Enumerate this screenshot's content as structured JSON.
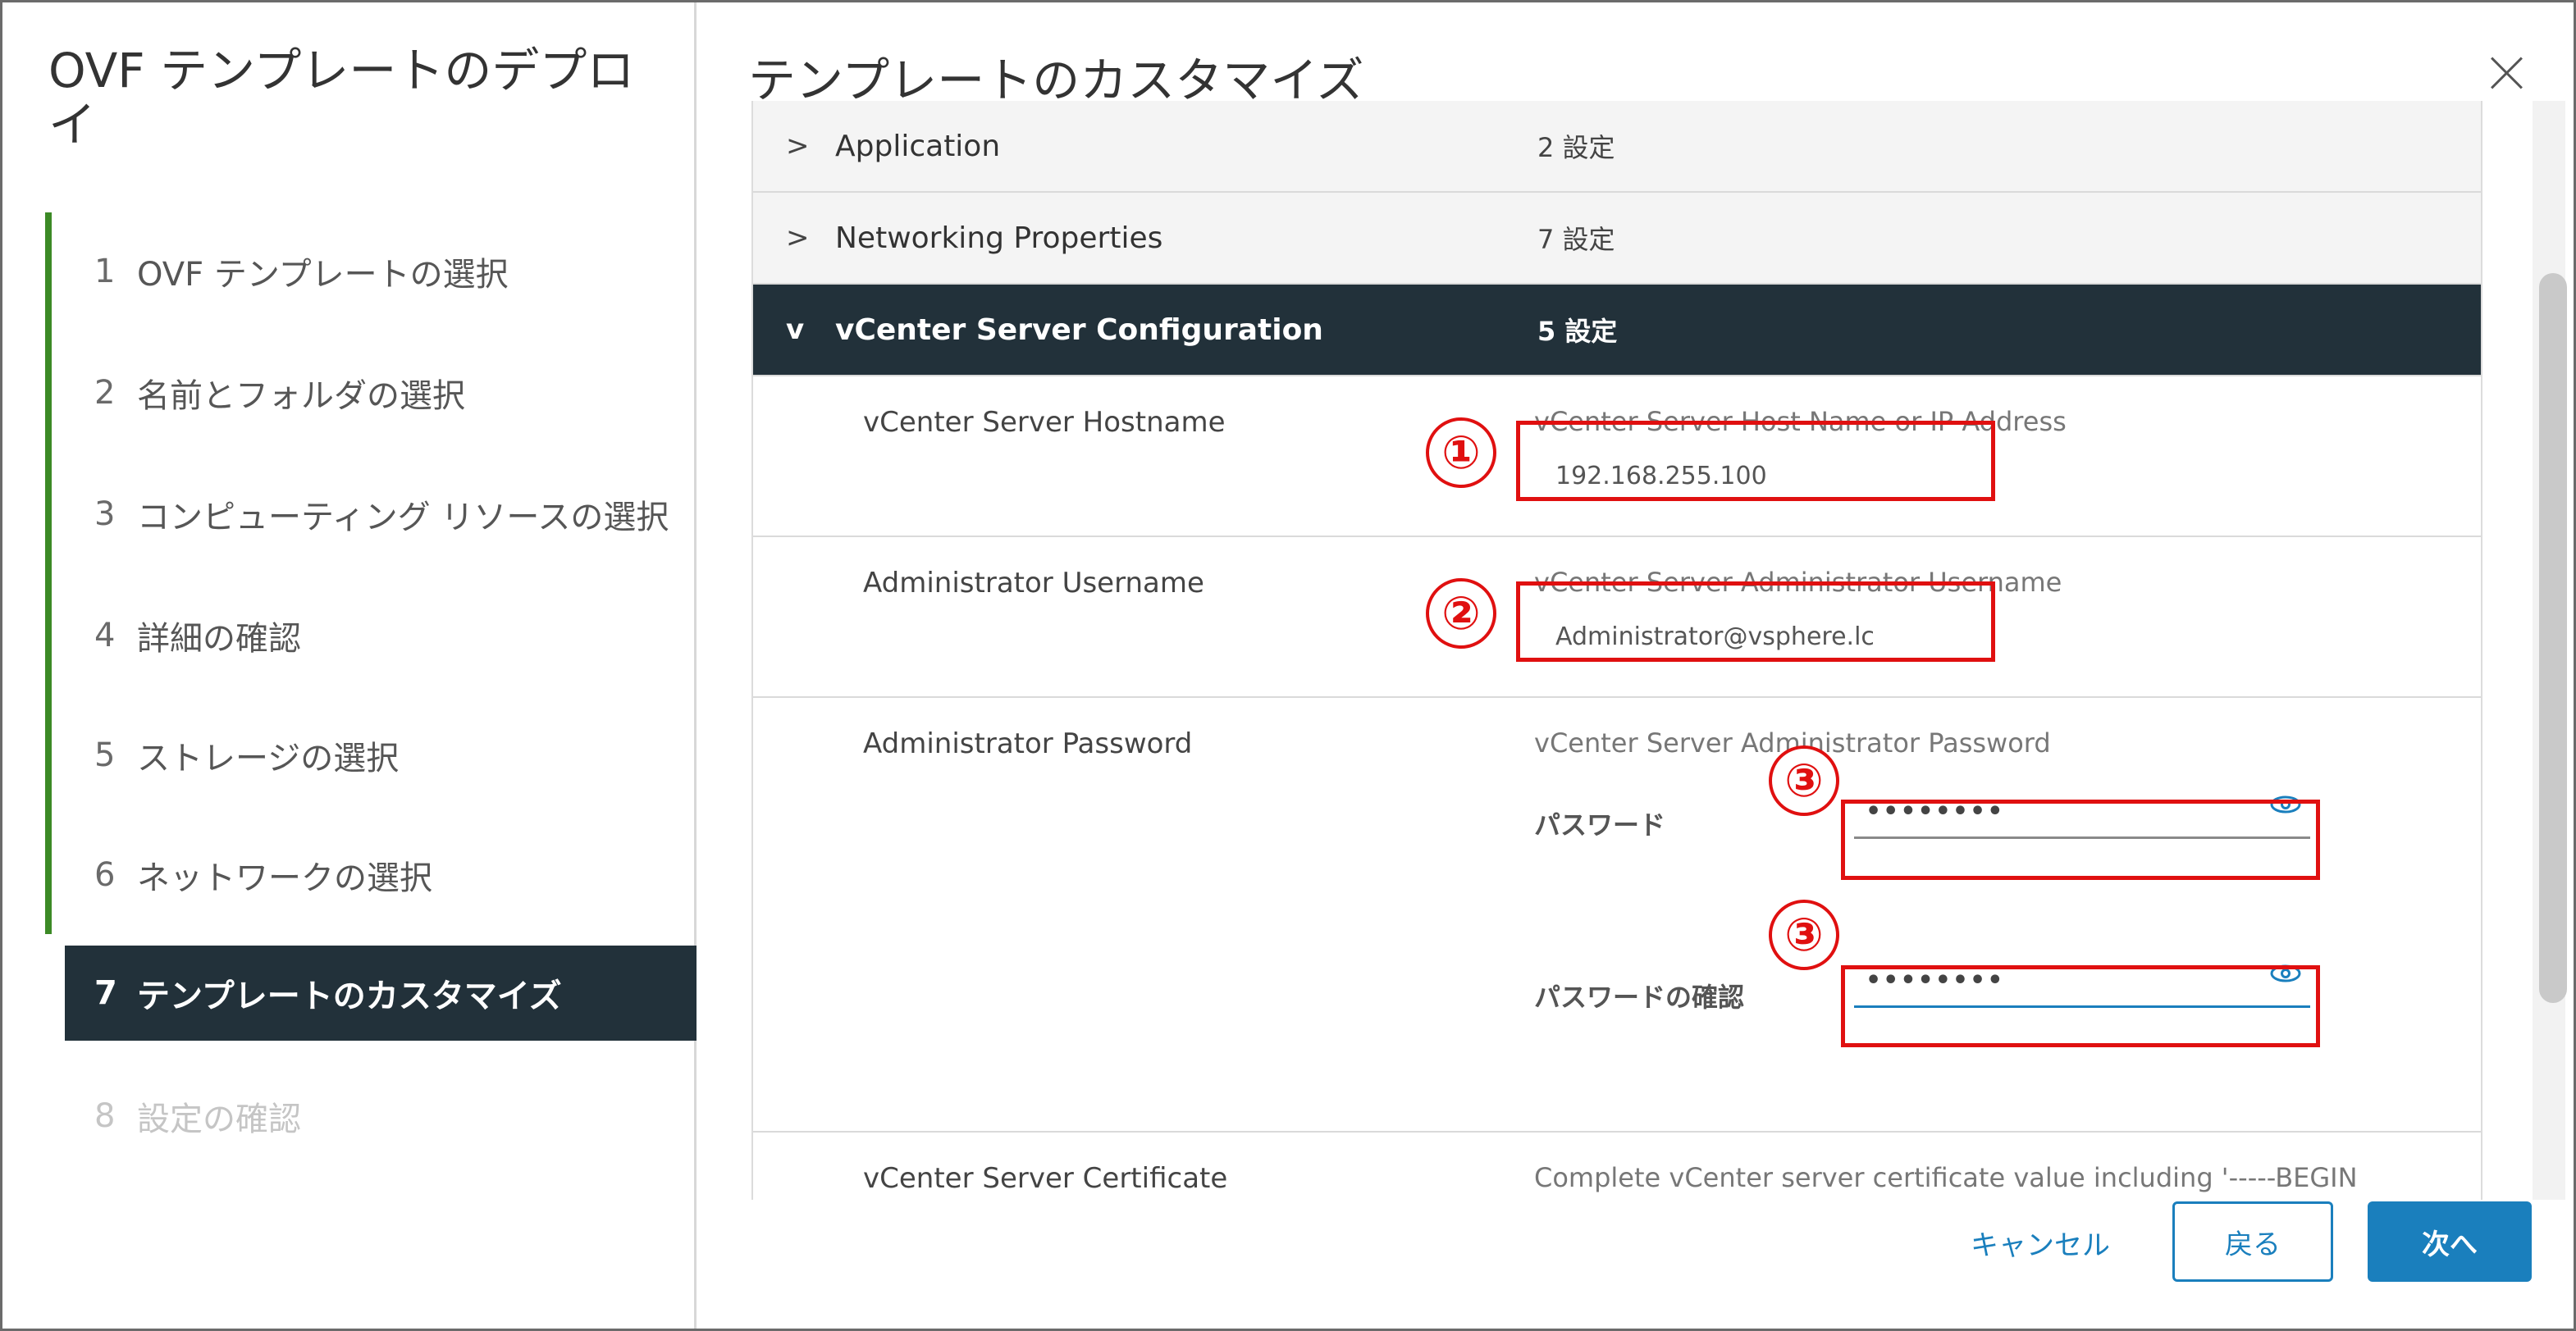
{
  "sidebar": {
    "title": "OVF テンプレートのデプロイ",
    "steps": [
      {
        "num": "1",
        "label": "OVF テンプレートの選択"
      },
      {
        "num": "2",
        "label": "名前とフォルダの選択"
      },
      {
        "num": "3",
        "label": "コンピューティング リソースの選択"
      },
      {
        "num": "4",
        "label": "詳細の確認"
      },
      {
        "num": "5",
        "label": "ストレージの選択"
      },
      {
        "num": "6",
        "label": "ネットワークの選択"
      },
      {
        "num": "7",
        "label": "テンプレートのカスタマイズ"
      },
      {
        "num": "8",
        "label": "設定の確認"
      }
    ]
  },
  "main": {
    "title": "テンプレートのカスタマイズ",
    "groups": [
      {
        "name": "Application",
        "count": "2 設定",
        "chevron": ">"
      },
      {
        "name": "Networking Properties",
        "count": "7 設定",
        "chevron": ">"
      },
      {
        "name": "vCenter Server Configuration",
        "count": "5 設定",
        "chevron": "v"
      }
    ],
    "properties": {
      "hostname": {
        "label": "vCenter Server Hostname",
        "desc": "vCenter Server Host Name or IP Address",
        "value": "192.168.255.100"
      },
      "username": {
        "label": "Administrator Username",
        "desc": "vCenter Server Administrator Username",
        "value": "Administrator@vsphere.lc"
      },
      "password": {
        "label": "Administrator Password",
        "desc": "vCenter Server Administrator Password",
        "pw_label": "パスワード",
        "pw_value": "••••••••",
        "confirm_label": "パスワードの確認",
        "confirm_value": "••••••••"
      },
      "certificate": {
        "label": "vCenter Server Certificate",
        "desc": "Complete vCenter server certificate value including '-----BEGIN"
      }
    },
    "markers": [
      "①",
      "②",
      "③",
      "③"
    ]
  },
  "footer": {
    "cancel": "キャンセル",
    "back": "戻る",
    "next": "次へ"
  },
  "colors": {
    "accent": "#1a7fbd",
    "active_bg": "#22313a",
    "rail": "#3c8a26",
    "annotation": "#e01010"
  }
}
